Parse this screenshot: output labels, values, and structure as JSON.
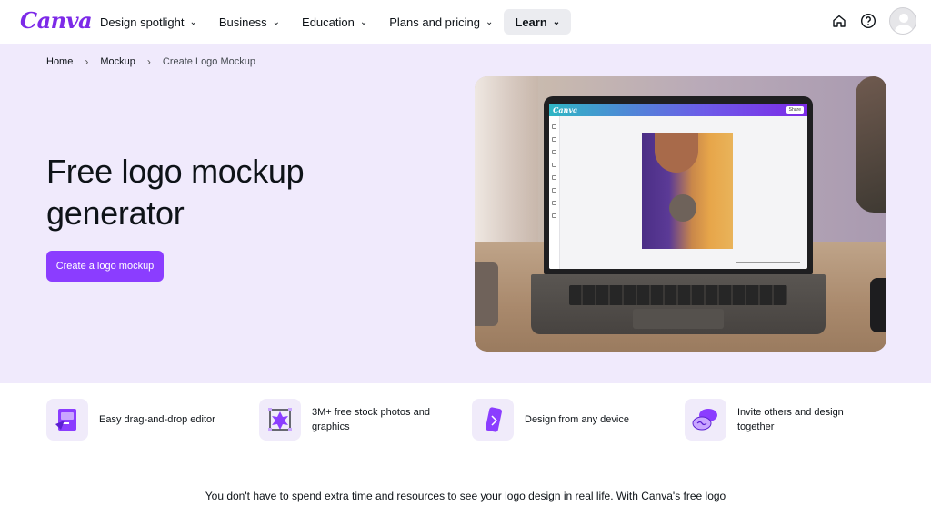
{
  "nav": {
    "logo": "Canva",
    "items": [
      {
        "label": "Design spotlight"
      },
      {
        "label": "Business"
      },
      {
        "label": "Education"
      },
      {
        "label": "Plans and pricing"
      },
      {
        "label": "Learn"
      }
    ],
    "icons": [
      "home-icon",
      "help-icon",
      "avatar"
    ]
  },
  "breadcrumb": {
    "items": [
      "Home",
      "Mockup",
      "Create Logo Mockup"
    ]
  },
  "hero": {
    "title": "Free logo mockup generator",
    "cta": "Create a logo mockup"
  },
  "laptop_app": {
    "logo": "Canva",
    "share": "Share"
  },
  "features": [
    {
      "icon": "drag-drop-editor-icon",
      "text": "Easy drag-and-drop editor"
    },
    {
      "icon": "stock-photos-icon",
      "text": "3M+ free stock photos and graphics"
    },
    {
      "icon": "mobile-device-icon",
      "text": "Design from any device"
    },
    {
      "icon": "collaborate-icon",
      "text": "Invite others and design together"
    }
  ],
  "intro_text": "You don't have to spend extra time and resources to see your logo design in real life. With Canva's free logo",
  "colors": {
    "brand": "#7d2ae8",
    "cta": "#8b3dff",
    "hero_bg": "#f0eafc"
  }
}
